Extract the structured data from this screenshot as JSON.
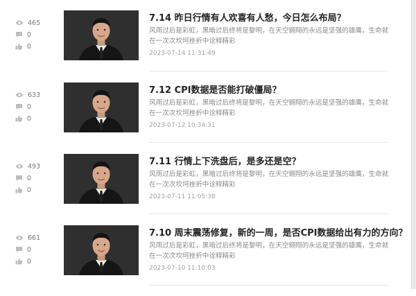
{
  "articles": [
    {
      "title": "7.14 昨日行情有人欢喜有人愁，今日怎么布局？",
      "excerpt": "风雨过后是彩虹，黑暗过后终将是黎明，在天空翱翔的永远是坚强的雄鹰，生命就在一次次坎坷挫折中诠释精彩",
      "date": "2023-07-14 11:31:49",
      "views": "465",
      "comments": "0",
      "likes": "0"
    },
    {
      "title": "7.12 CPI数据是否能打破僵局？",
      "excerpt": "风雨过后是彩虹，黑暗过后终将是黎明，在天空翱翔的永远是坚强的雄鹰，生命就在一次次坎坷挫折中诠释精彩",
      "date": "2023-07-12 10:34:31",
      "views": "633",
      "comments": "0",
      "likes": "0"
    },
    {
      "title": "7.11 行情上下洗盘后，是多还是空？",
      "excerpt": "风雨过后是彩虹，黑暗过后终将是黎明，在天空翱翔的永远是坚强的雄鹰，生命就在一次次坎坷挫折中诠释精彩",
      "date": "2023-07-11 11:05:38",
      "views": "493",
      "comments": "0",
      "likes": "0"
    },
    {
      "title": "7.10 周末震荡修复，新的一周，是否CPI数据给出有力的方向？",
      "excerpt": "风雨过后是彩虹，黑暗过后终将是黎明，在天空翱翔的永远是坚强的雄鹰，生命就在一次次坎坷挫折中诠释精彩",
      "date": "2023-07-10 11:10:03",
      "views": "661",
      "comments": "0",
      "likes": "0"
    }
  ],
  "icons": {
    "views": "eye-icon",
    "comments": "comment-icon",
    "likes": "thumbs-up-icon"
  },
  "colors": {
    "title": "#222222",
    "excerpt": "#8a8a8a",
    "meta": "#a0a0a0",
    "icon": "#b5b5b5"
  }
}
